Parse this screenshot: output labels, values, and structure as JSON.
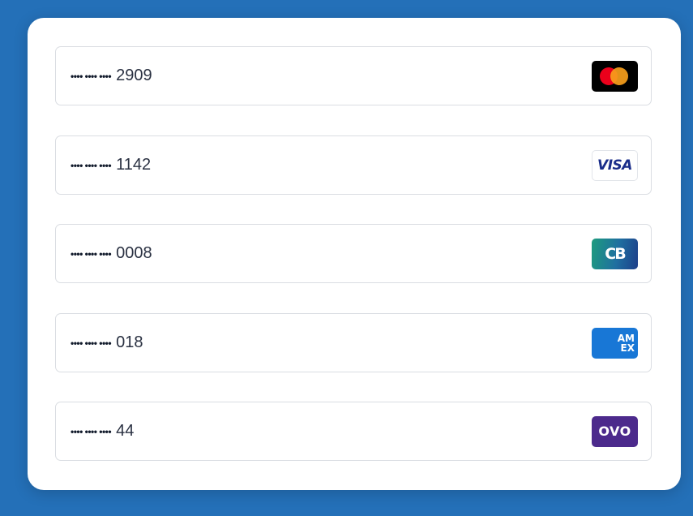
{
  "cards": [
    {
      "mask": "•••• •••• ••••",
      "last_digits": "2909",
      "brand": "mastercard",
      "brand_icon": "mastercard-logo-icon"
    },
    {
      "mask": "•••• •••• ••••",
      "last_digits": "1142",
      "brand": "visa",
      "brand_text": "VISA",
      "brand_icon": "visa-logo-icon"
    },
    {
      "mask": "•••• •••• ••••",
      "last_digits": "0008",
      "brand": "cb",
      "brand_text": "CB",
      "brand_icon": "cb-logo-icon"
    },
    {
      "mask": "•••• •••• ••••",
      "last_digits": "018",
      "brand": "amex",
      "brand_text_top": "AM",
      "brand_text_bottom": "EX",
      "brand_icon": "amex-logo-icon"
    },
    {
      "mask": "•••• •••• ••••",
      "last_digits": "44",
      "brand": "ovo",
      "brand_text": "OVO",
      "brand_icon": "ovo-logo-icon"
    }
  ],
  "colors": {
    "background": "#2470b8",
    "panel": "#ffffff",
    "row_border": "#dadde2",
    "mastercard_red": "#eb001b",
    "mastercard_orange": "#f79e1b",
    "visa_blue": "#1a2d8a",
    "amex_blue": "#1877d6",
    "ovo_purple": "#4c2a8c"
  }
}
